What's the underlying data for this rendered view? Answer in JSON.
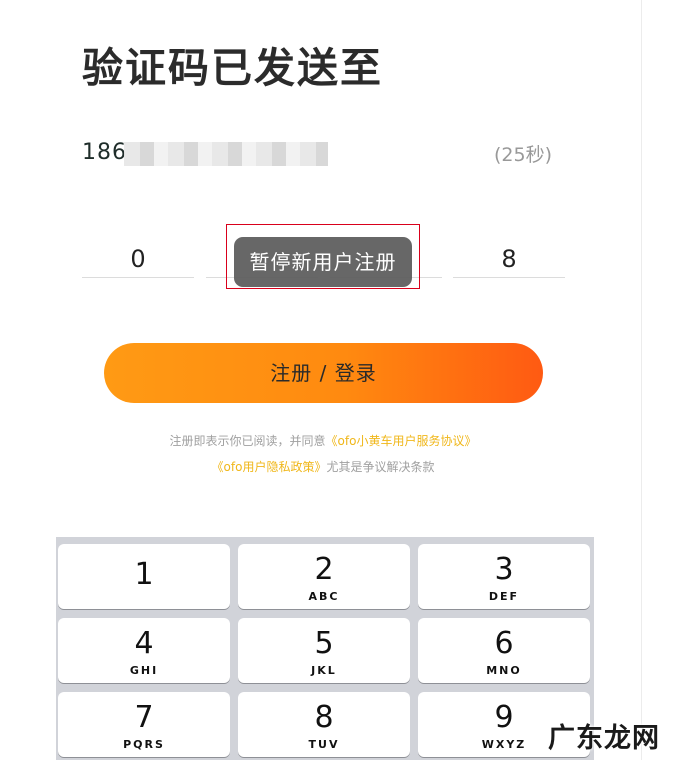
{
  "header": {
    "title": "验证码已发送至"
  },
  "phone": {
    "prefix": "186",
    "countdown": "(25秒)"
  },
  "code": {
    "digits": [
      "0",
      "",
      "",
      "8"
    ]
  },
  "toast": {
    "text": "暂停新用户注册"
  },
  "submit": {
    "label": "注册 / 登录"
  },
  "agreement": {
    "prefix": "注册即表示你已阅读，并同意",
    "service_link": "《ofo小黄车用户服务协议》",
    "privacy_link": "《ofo用户隐私政策》",
    "suffix": "尤其是争议解决条款"
  },
  "keypad": {
    "keys": [
      {
        "num": "1",
        "letters": ""
      },
      {
        "num": "2",
        "letters": "ABC"
      },
      {
        "num": "3",
        "letters": "DEF"
      },
      {
        "num": "4",
        "letters": "GHI"
      },
      {
        "num": "5",
        "letters": "JKL"
      },
      {
        "num": "6",
        "letters": "MNO"
      },
      {
        "num": "7",
        "letters": "PQRS"
      },
      {
        "num": "8",
        "letters": "TUV"
      },
      {
        "num": "9",
        "letters": "WXYZ"
      }
    ]
  },
  "watermark": {
    "text": "广东龙网"
  },
  "colors": {
    "accent": "#ff8a10",
    "link": "#f0b71a",
    "toast_bg": "#5a5a5a",
    "highlight_frame": "#d9001b"
  }
}
